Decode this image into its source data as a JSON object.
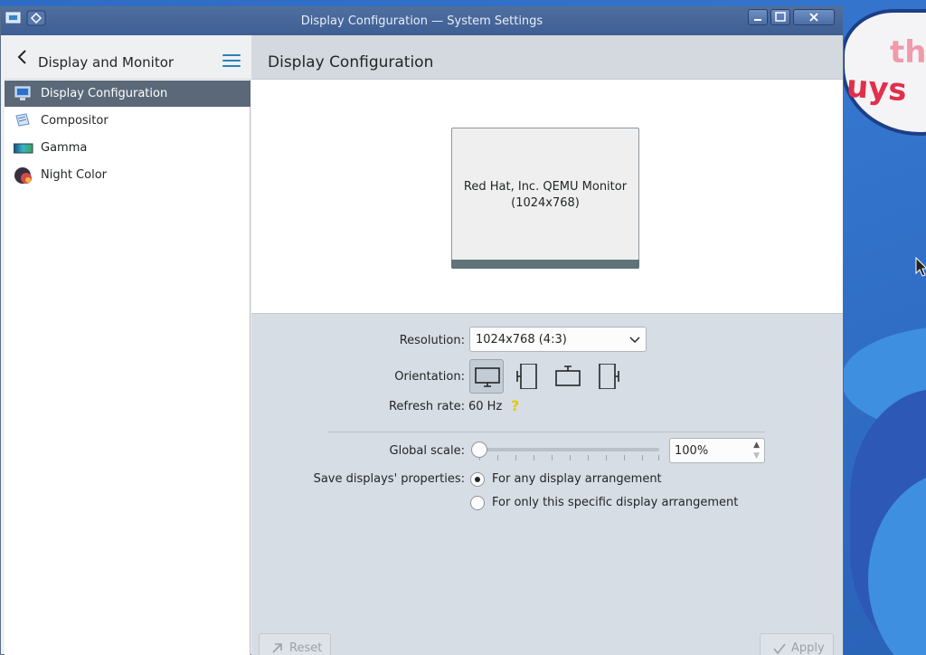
{
  "window": {
    "title": "Display Configuration — System Settings"
  },
  "sidebar": {
    "title": "Display and Monitor",
    "items": [
      {
        "label": "Display Configuration",
        "icon": "display-icon",
        "active": true
      },
      {
        "label": "Compositor",
        "icon": "compositor-icon",
        "active": false
      },
      {
        "label": "Gamma",
        "icon": "gamma-icon",
        "active": false
      },
      {
        "label": "Night Color",
        "icon": "night-color-icon",
        "active": false
      }
    ]
  },
  "main": {
    "title": "Display Configuration",
    "monitor": {
      "name": "Red Hat, Inc. QEMU Monitor",
      "resolution": "(1024x768)"
    },
    "resolution": {
      "label": "Resolution:",
      "value": "1024x768 (4:3)"
    },
    "orientation": {
      "label": "Orientation:",
      "options": [
        "landscape",
        "portrait-left",
        "landscape-flipped",
        "portrait-right"
      ],
      "selected": "landscape"
    },
    "refresh_rate": {
      "label": "Refresh rate:",
      "value": "60 Hz"
    },
    "global_scale": {
      "label": "Global scale:",
      "value": "100%",
      "slider_level": 0
    },
    "save_properties": {
      "label": "Save displays' properties:",
      "options": [
        {
          "label": "For any display arrangement",
          "checked": true
        },
        {
          "label": "For only this specific display arrangement",
          "checked": false
        }
      ]
    }
  },
  "footer": {
    "reset_label": "Reset",
    "apply_label": "Apply"
  },
  "colors": {
    "accent": "#2980b9",
    "selection": "#5a6878",
    "titlebar": "#475f8f"
  }
}
